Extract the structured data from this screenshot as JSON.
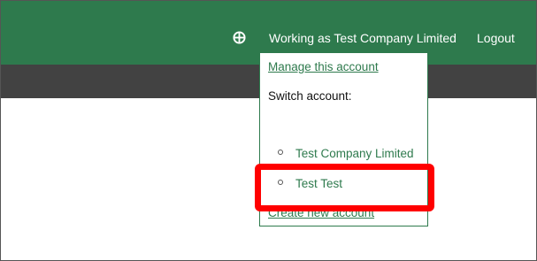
{
  "header": {
    "globe_icon": "globe-icon",
    "working_as": "Working as Test Company Limited",
    "logout": "Logout",
    "bar_color": "#2e7a4d",
    "subbar_color": "#424242"
  },
  "account_menu": {
    "manage_link": "Manage this account",
    "switch_label": "Switch account:",
    "accounts": [
      {
        "label": "Test Company Limited"
      },
      {
        "label": "Test Test"
      }
    ],
    "create_link": "Create new account"
  },
  "annotation": {
    "highlight_color": "#ff0000"
  }
}
